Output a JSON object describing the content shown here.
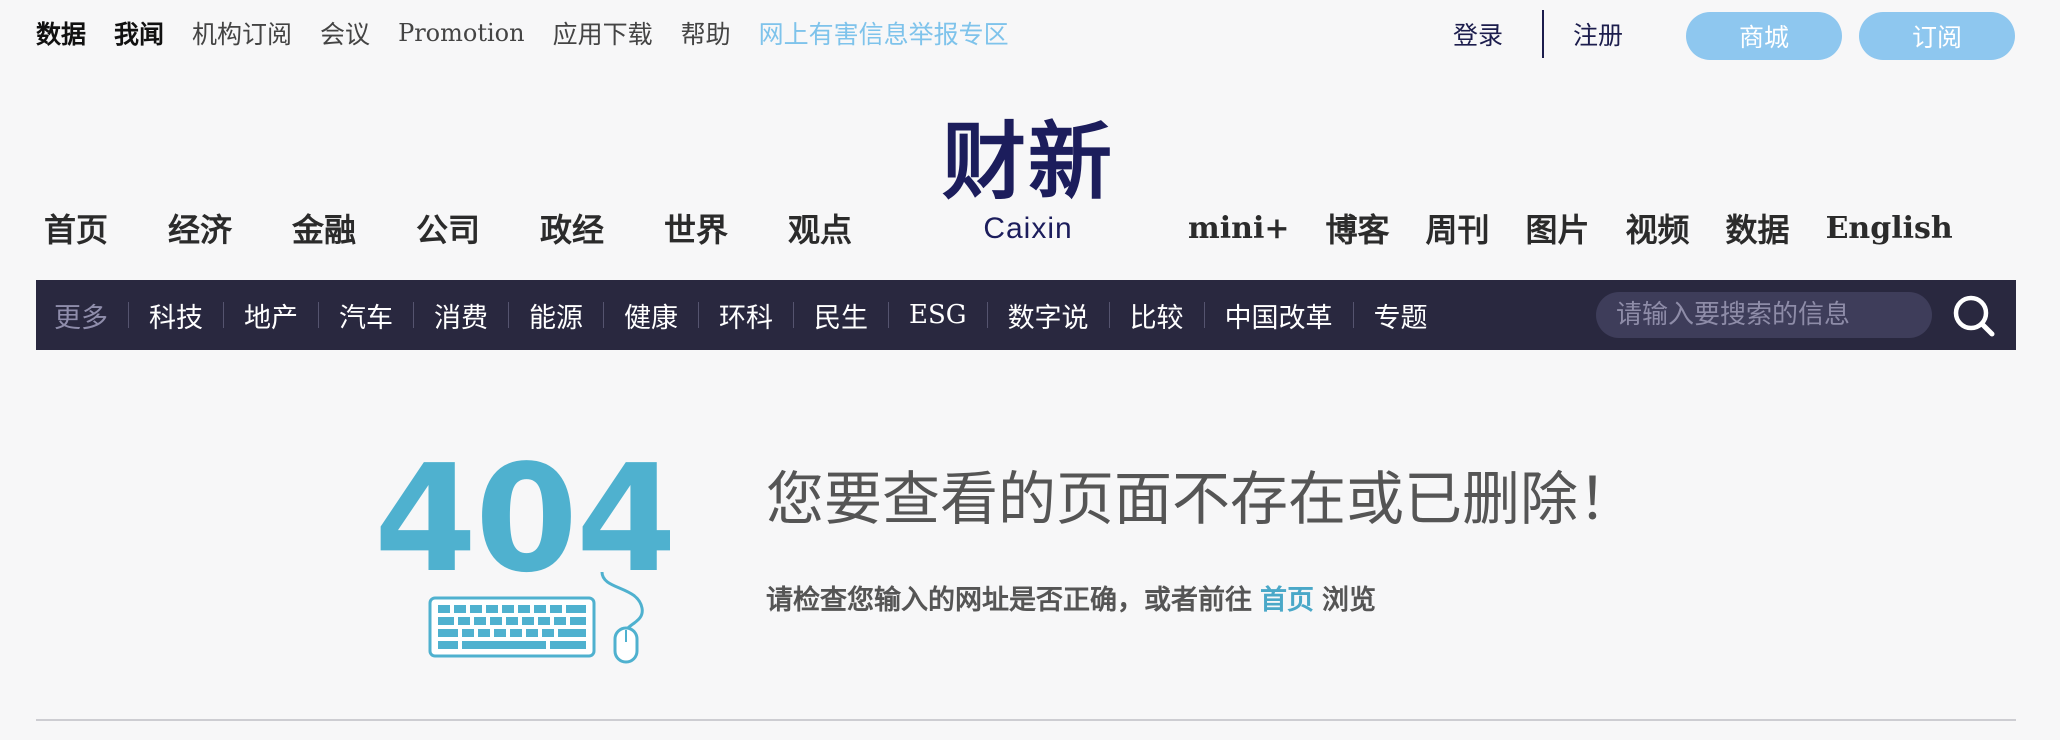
{
  "topbar": {
    "items": [
      {
        "label": "数据"
      },
      {
        "label": "我闻"
      },
      {
        "label": "机构订阅"
      },
      {
        "label": "会议"
      },
      {
        "label": "Promotion"
      },
      {
        "label": "应用下载"
      },
      {
        "label": "帮助"
      },
      {
        "label": "网上有害信息举报专区"
      }
    ],
    "login": "登录",
    "register": "注册",
    "mall": "商城",
    "subscribe": "订阅"
  },
  "logo": {
    "cn": "财新",
    "en": "Caixin"
  },
  "main_nav": {
    "left": [
      "首页",
      "经济",
      "金融",
      "公司",
      "政经",
      "世界",
      "观点"
    ],
    "right": [
      "mini+",
      "博客",
      "周刊",
      "图片",
      "视频",
      "数据",
      "English"
    ]
  },
  "sub_nav": {
    "items": [
      "更多",
      "科技",
      "地产",
      "汽车",
      "消费",
      "能源",
      "健康",
      "环科",
      "民生",
      "ESG",
      "数字说",
      "比较",
      "中国改革",
      "专题"
    ],
    "search_placeholder": "请输入要搜索的信息"
  },
  "error": {
    "code": "404",
    "title": "您要查看的页面不存在或已删除！",
    "desc_lead": "请检查您输入的网址是否正确，或者前往",
    "home_link": "首页",
    "desc_tail": "浏览"
  },
  "colors": {
    "nav_bar_bg": "#29283f",
    "accent_blue": "#8ec7ef",
    "error_teal": "#4fb1cf",
    "logo_navy": "#1c1d5c"
  },
  "icons": [
    "search-icon",
    "keyboard-icon",
    "mouse-icon"
  ]
}
